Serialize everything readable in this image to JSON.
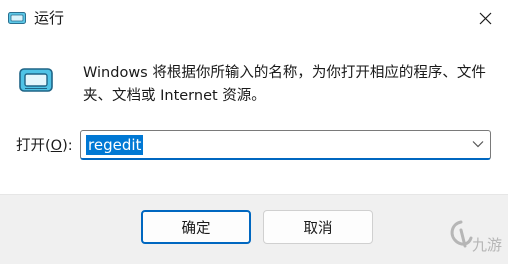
{
  "window": {
    "title": "运行",
    "icon": "run-dialog-icon",
    "close_icon": "close-icon"
  },
  "description": "Windows 将根据你所输入的名称，为你打开相应的程序、文件夹、文档或 Internet 资源。",
  "open_field": {
    "label_prefix": "打开(",
    "label_accel": "O",
    "label_suffix": "):",
    "value": "regedit",
    "dropdown_icon": "chevron-down-icon"
  },
  "buttons": {
    "ok": "确定",
    "cancel": "取消"
  },
  "watermark": {
    "text": "九游",
    "icon": "jiuyou-logo-icon"
  },
  "colors": {
    "accent": "#0067c0",
    "selection": "#0078d4"
  }
}
